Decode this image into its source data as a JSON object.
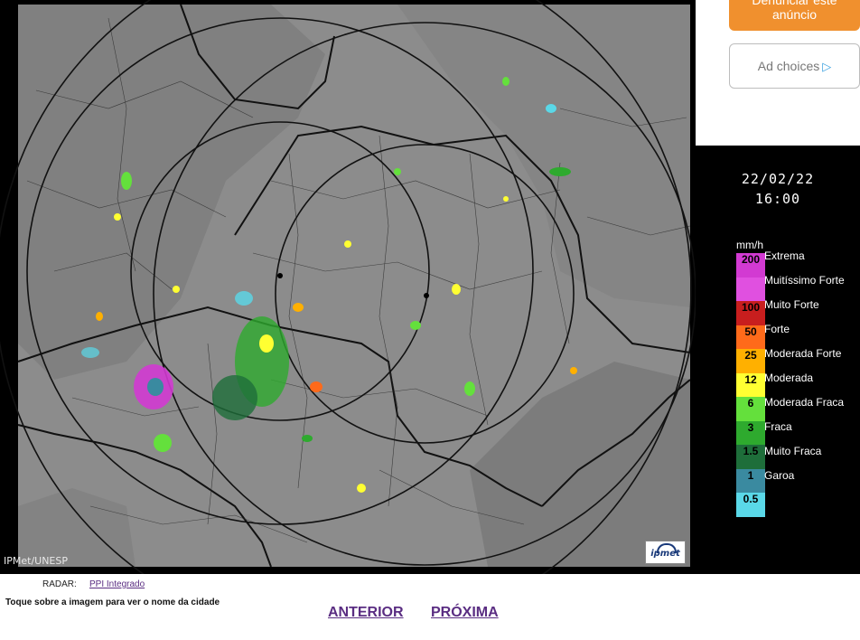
{
  "radar_image": {
    "credit": "IPMet/UNESP",
    "logo_text": "ipmet"
  },
  "ad": {
    "report_label": "Denunciar este anúncio",
    "choices_label": "Ad choices",
    "choices_icon": "adchoices-triangle-icon"
  },
  "timestamp": {
    "date": "22/02/22",
    "time": "16:00"
  },
  "legend": {
    "unit": "mm/h",
    "scale": [
      {
        "value": "200",
        "label": "Extrema",
        "color": "#d23ad2"
      },
      {
        "value": "",
        "label": "Muitíssimo Forte",
        "color": "#e050e0"
      },
      {
        "value": "100",
        "label": "Muito Forte",
        "color": "#c81e1e"
      },
      {
        "value": "50",
        "label": "Forte",
        "color": "#ff6a1a"
      },
      {
        "value": "25",
        "label": "Moderada Forte",
        "color": "#ffb000"
      },
      {
        "value": "12",
        "label": "Moderada",
        "color": "#ffff32"
      },
      {
        "value": "6",
        "label": "Moderada Fraca",
        "color": "#64e03c"
      },
      {
        "value": "3",
        "label": "Fraca",
        "color": "#2eaa2e"
      },
      {
        "value": "1.5",
        "label": "Muito Fraca",
        "color": "#1e6e3a"
      },
      {
        "value": "1",
        "label": "Garoa",
        "color": "#3a8aa0"
      },
      {
        "value": "0.5",
        "label": "",
        "color": "#5ad8e8"
      }
    ]
  },
  "footer": {
    "radar_label": "RADAR:",
    "radar_link": "PPI Integrado",
    "hint": "Toque sobre a imagem para ver o nome da cidade",
    "prev_label": "ANTERIOR",
    "next_label": "PRÓXIMA"
  }
}
